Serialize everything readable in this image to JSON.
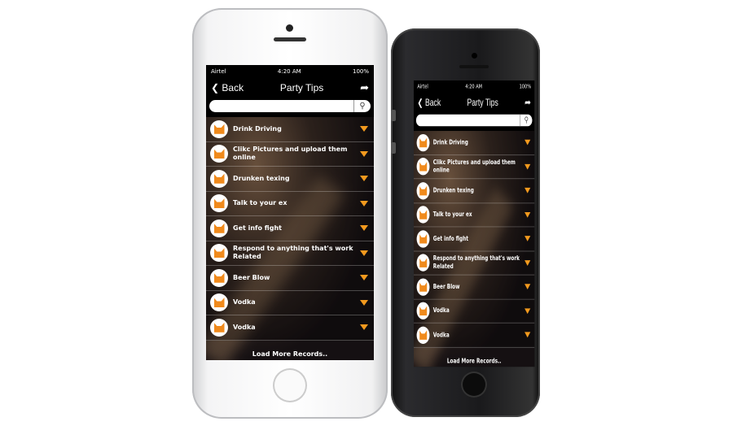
{
  "status": {
    "carrier": "Airtel",
    "time": "4:20 AM",
    "battery": "100%"
  },
  "nav": {
    "back": "Back",
    "title": "Party Tips",
    "share_icon": "share-icon"
  },
  "search": {
    "placeholder": "",
    "icon": "search-icon"
  },
  "items": [
    "Drink Driving",
    "Clikc Pictures and upload them online",
    "Drunken texing",
    "Talk to your ex",
    "Get info fight",
    "Respond to anything that's work Related",
    "Beer Blow",
    "Vodka",
    "Vodka"
  ],
  "load_more": "Load More Records..",
  "colors": {
    "accent": "#f39a1e"
  }
}
